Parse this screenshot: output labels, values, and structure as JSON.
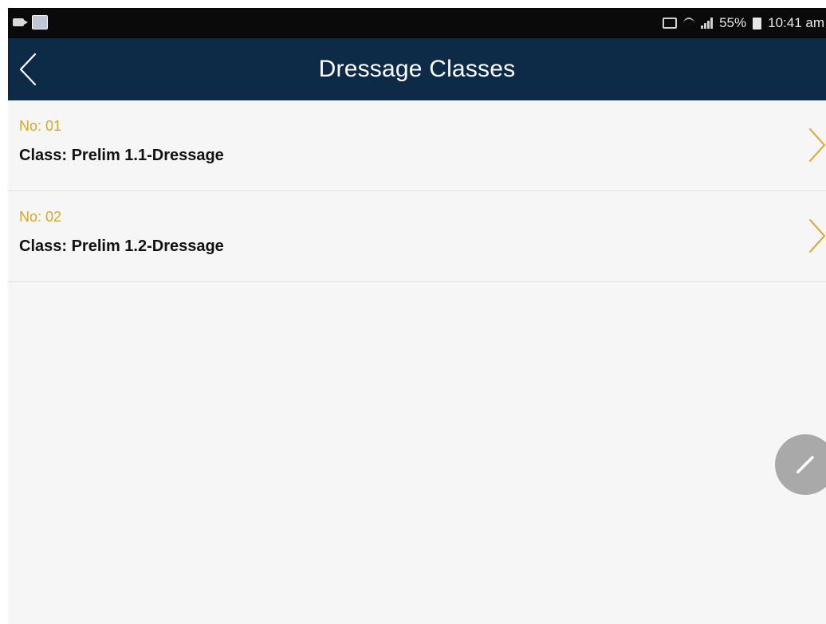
{
  "status_bar": {
    "battery": "55%",
    "time": "10:41 am",
    "icons": [
      "video-icon",
      "gallery-icon",
      "cast-icon",
      "wifi-icon",
      "signal-icon",
      "battery-icon"
    ]
  },
  "header": {
    "title": "Dressage Classes",
    "back_icon": "chevron-left-icon",
    "background": "#0d2b47"
  },
  "classes": [
    {
      "number": "No: 01",
      "class": "Class: Prelim 1.1-Dressage"
    },
    {
      "number": "No: 02",
      "class": "Class: Prelim 1.2-Dressage"
    }
  ],
  "accent_color": "#d9a62c",
  "fab": {
    "icon": "pencil-icon"
  }
}
